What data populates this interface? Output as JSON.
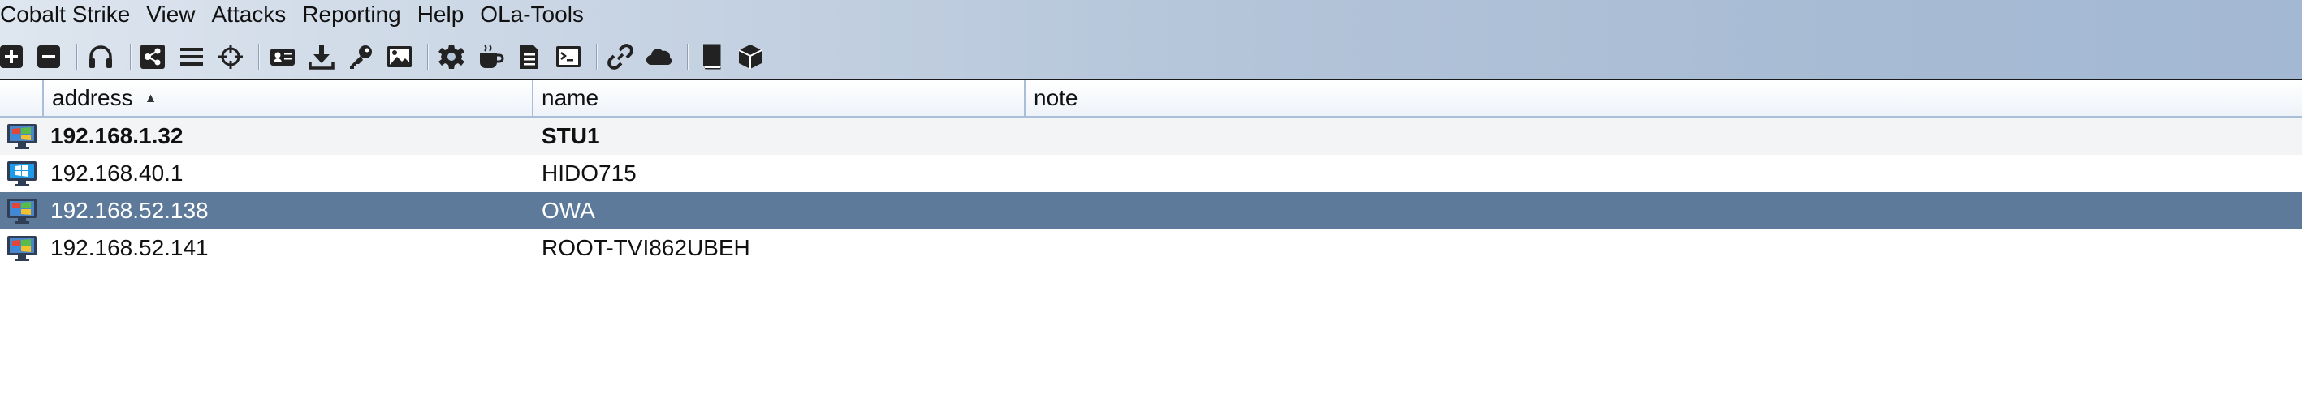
{
  "menu": [
    "Cobalt Strike",
    "View",
    "Attacks",
    "Reporting",
    "Help",
    "OLa-Tools"
  ],
  "toolbar": [
    {
      "icon": "plus-icon"
    },
    {
      "icon": "minus-icon"
    },
    {
      "icon": "headphones-icon"
    },
    {
      "icon": "pivot-graph-icon"
    },
    {
      "icon": "list-icon"
    },
    {
      "icon": "crosshair-icon"
    },
    {
      "icon": "credentials-icon"
    },
    {
      "icon": "download-icon"
    },
    {
      "icon": "key-icon"
    },
    {
      "icon": "image-icon"
    },
    {
      "icon": "gear-icon"
    },
    {
      "icon": "coffee-icon"
    },
    {
      "icon": "document-icon"
    },
    {
      "icon": "terminal-icon"
    },
    {
      "icon": "link-icon"
    },
    {
      "icon": "cloud-icon"
    },
    {
      "icon": "book-icon"
    },
    {
      "icon": "cube-icon"
    }
  ],
  "table": {
    "columns": [
      "address",
      "name",
      "note"
    ],
    "sort": {
      "column": "address",
      "direction": "ascending"
    },
    "rows": [
      {
        "icon": "windows-host-icon",
        "address": "192.168.1.32",
        "name": "STU1",
        "note": "",
        "bold": true,
        "selected": false
      },
      {
        "icon": "windows10-host-icon",
        "address": "192.168.40.1",
        "name": "HIDO715",
        "note": "",
        "bold": false,
        "selected": false
      },
      {
        "icon": "windows-host-icon",
        "address": "192.168.52.138",
        "name": "OWA",
        "note": "",
        "bold": false,
        "selected": true
      },
      {
        "icon": "windows-host-icon",
        "address": "192.168.52.141",
        "name": "ROOT-TVI862UBEH",
        "note": "",
        "bold": false,
        "selected": false
      }
    ]
  },
  "colors": {
    "selected_row": "#5d7a9b",
    "header_border": "#a9bfd9"
  }
}
